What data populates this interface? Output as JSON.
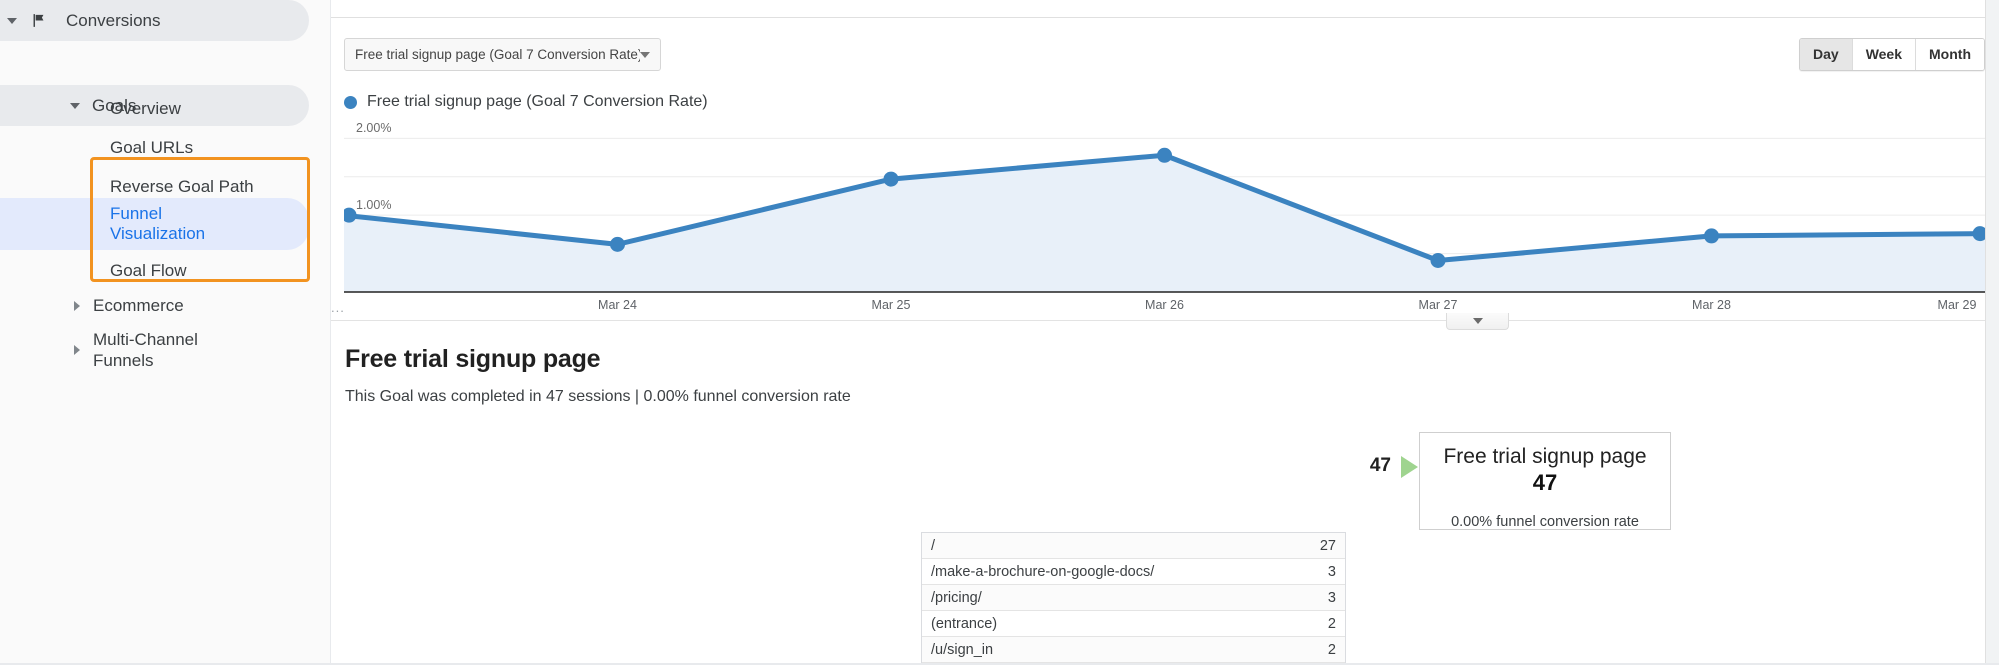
{
  "sidebar": {
    "conversions": {
      "label": "Conversions",
      "icon": "flag-icon"
    },
    "goals": {
      "label": "Goals"
    },
    "goal_items": [
      {
        "label": "Overview",
        "active": false
      },
      {
        "label": "Goal URLs",
        "active": false
      },
      {
        "label": "Reverse Goal Path",
        "active": false
      },
      {
        "label": "Funnel Visualization",
        "active": true
      },
      {
        "label": "Goal Flow",
        "active": false
      }
    ],
    "ecommerce": {
      "label": "Ecommerce"
    },
    "multi_channel": {
      "label": "Multi-Channel Funnels"
    },
    "highlight_color": "#f29320"
  },
  "toolbar": {
    "goal_selector_value": "Free trial signup page (Goal 7 Conversion Rate)",
    "granularity": [
      {
        "label": "Day",
        "selected": true
      },
      {
        "label": "Week",
        "selected": false
      },
      {
        "label": "Month",
        "selected": false
      }
    ]
  },
  "legend": {
    "series_label": "Free trial signup page (Goal 7 Conversion Rate)",
    "series_color": "#3b83c0"
  },
  "chart_data": {
    "type": "line",
    "title": "",
    "subtitle": "",
    "xlabel": "",
    "ylabel": "",
    "series_name": "Free trial signup page (Goal 7 Conversion Rate)",
    "line_color": "#3b83c0",
    "fill_color": "#e8f0f9",
    "categories": [
      "...",
      "Mar 24",
      "Mar 25",
      "Mar 26",
      "Mar 27",
      "Mar 28",
      "Mar 29"
    ],
    "x": [
      "...",
      "Mar 24",
      "Mar 25",
      "Mar 26",
      "Mar 27",
      "Mar 28",
      "Mar 29"
    ],
    "values": [
      1.0,
      0.62,
      1.47,
      1.78,
      0.41,
      0.73,
      0.76
    ],
    "ytick_labels": [
      "2.00%",
      "1.00%"
    ],
    "ytick_values": [
      2.0,
      1.0
    ],
    "gridlines": [
      2.0,
      1.5,
      1.0,
      0.5
    ],
    "ylim": [
      0,
      2.2
    ],
    "grid": true,
    "legend_position": "top-left",
    "markers": true,
    "area_fill": true
  },
  "funnel": {
    "title": "Free trial signup page",
    "subtitle": "This Goal was completed in 47 sessions | 0.00% funnel conversion rate",
    "entry_total": "47",
    "goal_box": {
      "name": "Free trial signup page",
      "count": "47",
      "rate": "0.00% funnel conversion rate"
    },
    "entry_rows": [
      {
        "url": "/",
        "count": "27"
      },
      {
        "url": "/make-a-brochure-on-google-docs/",
        "count": "3"
      },
      {
        "url": "/pricing/",
        "count": "3"
      },
      {
        "url": "(entrance)",
        "count": "2"
      },
      {
        "url": "/u/sign_in",
        "count": "2"
      }
    ],
    "arrow_color": "#9fd48f"
  },
  "chart_footer": {
    "collapse_icon": "chevron-down-icon"
  },
  "x_axis_ellipsis": "..."
}
